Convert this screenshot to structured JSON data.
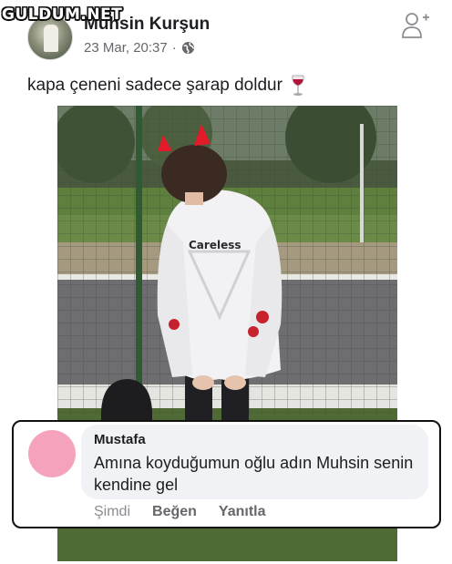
{
  "watermark": "GULDUM.NET",
  "post": {
    "author": "Muhsin Kurşun",
    "timestamp": "23 Mar, 20:37",
    "separator": "·",
    "privacy_icon": "globe-icon",
    "text": "kapa çeneni sadece şarap doldur",
    "emoji_icon": "wine-glass-icon",
    "photo_shirt_text": "Careless"
  },
  "header": {
    "add_friend_icon": "add-friend-icon"
  },
  "comment": {
    "name": "Mustafa",
    "avatar_color": "#f5a3bc",
    "text": "Amına koyduğumun oğlu adın Muhsin senin kendine gel",
    "time": "Şimdi",
    "like_label": "Beğen",
    "reply_label": "Yanıtla"
  },
  "colors": {
    "text": "#1c1e21",
    "secondary": "#65676b",
    "bubble": "#f0f2f5"
  }
}
